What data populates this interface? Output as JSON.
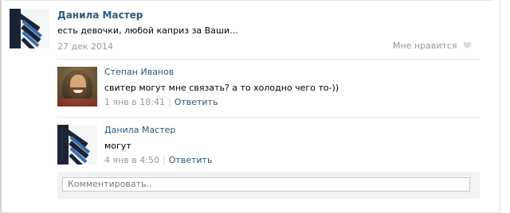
{
  "post": {
    "author": "Данила Мастер",
    "text": "есть девочки, любой каприз за Ваши...",
    "date": "27 дек 2014",
    "like_label": "Мне нравится"
  },
  "comments": [
    {
      "author": "Степан Иванов",
      "text": "свитер могут мне связать? а то холодно чего то-))",
      "date": "1 янв в 18:41",
      "reply_label": "Ответить"
    },
    {
      "author": "Данила Мастер",
      "text": "могут",
      "date": "4 янв в 4:50",
      "reply_label": "Ответить"
    }
  ],
  "comment_input": {
    "placeholder": "Комментировать.."
  },
  "colors": {
    "link": "#2b587a",
    "meta": "#999999",
    "input_bg": "#f2f3f5"
  }
}
